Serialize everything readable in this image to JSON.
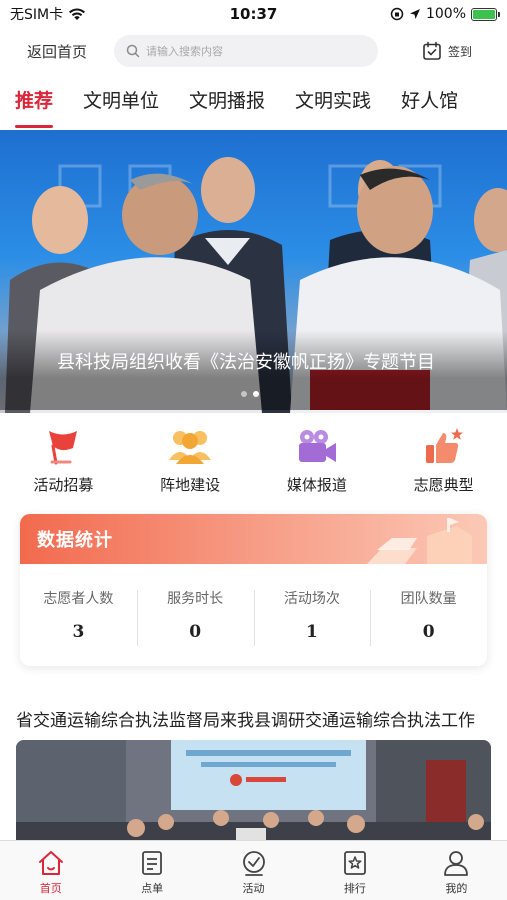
{
  "status_bar": {
    "carrier": "无SIM卡",
    "time": "10:37",
    "battery_percent": "100%",
    "battery_level": 1.0
  },
  "top_nav": {
    "back_label": "返回首页",
    "search_placeholder": "请输入搜索内容",
    "sign_in_label": "签到"
  },
  "tabs": [
    {
      "label": "推荐",
      "active": true
    },
    {
      "label": "文明单位",
      "active": false
    },
    {
      "label": "文明播报",
      "active": false
    },
    {
      "label": "文明实践",
      "active": false
    },
    {
      "label": "好人馆",
      "active": false
    }
  ],
  "banner": {
    "caption": "县科技局组织收看《法治安徽帆正扬》专题节目",
    "slide_count": 2,
    "active_slide": 2
  },
  "quick_actions": [
    {
      "label": "活动招募",
      "icon": "flag-icon",
      "color": "#e8423a"
    },
    {
      "label": "阵地建设",
      "icon": "people-icon",
      "color": "#f2a634"
    },
    {
      "label": "媒体报道",
      "icon": "video-camera-icon",
      "color": "#a26bd6"
    },
    {
      "label": "志愿典型",
      "icon": "thumbs-up-icon",
      "color": "#ee6a4c"
    }
  ],
  "stats": {
    "title": "数据统计",
    "items": [
      {
        "label": "志愿者人数",
        "value": "3"
      },
      {
        "label": "服务时长",
        "value": "0"
      },
      {
        "label": "活动场次",
        "value": "1"
      },
      {
        "label": "团队数量",
        "value": "0"
      }
    ]
  },
  "news": {
    "title": "省交通运输综合执法监督局来我县调研交通运输综合执法工作"
  },
  "tabbar": [
    {
      "label": "首页",
      "icon": "home-icon",
      "active": true
    },
    {
      "label": "点单",
      "icon": "order-icon",
      "active": false
    },
    {
      "label": "活动",
      "icon": "activity-icon",
      "active": false
    },
    {
      "label": "排行",
      "icon": "ranking-icon",
      "active": false
    },
    {
      "label": "我的",
      "icon": "profile-icon",
      "active": false
    }
  ],
  "colors": {
    "accent": "#d9263a",
    "stats_header": "#f26a4e"
  }
}
